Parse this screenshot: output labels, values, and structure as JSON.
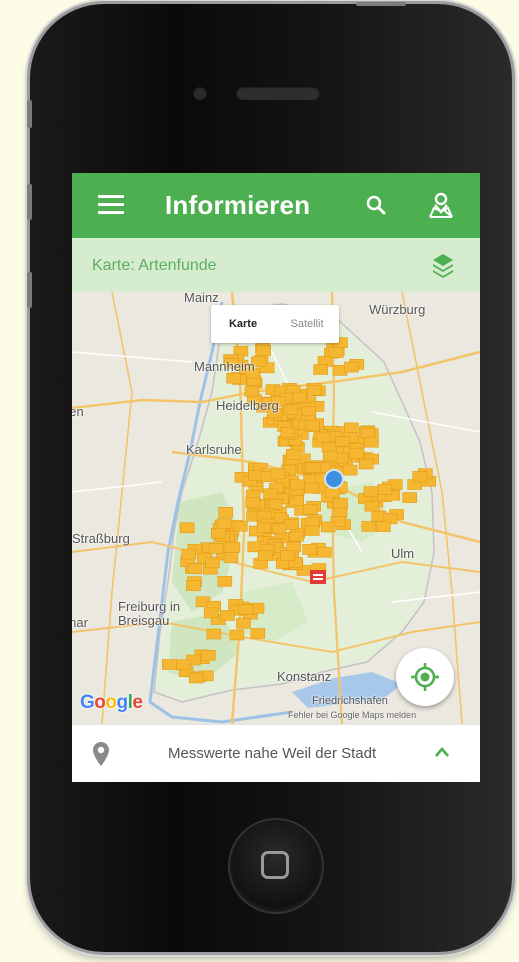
{
  "app": {
    "title": "Informieren",
    "accent_color": "#4caf50",
    "subbar_color": "#d6eccf"
  },
  "appbar": {
    "menu_icon": "menu-icon",
    "search_icon": "search-icon",
    "account_icon": "account-map-icon"
  },
  "subbar": {
    "label": "Karte: Artenfunde",
    "layers_icon": "layers-icon"
  },
  "map": {
    "map_type": {
      "karte": "Karte",
      "satellit": "Satellit",
      "selected": "Karte"
    },
    "cities": {
      "mainz": "Mainz",
      "wuerzburg": "Würzburg",
      "mannheim": "Mannheim",
      "heidelberg": "Heidelberg",
      "karlsruhe": "Karlsruhe",
      "strasbourg": "Straßburg",
      "ulm": "Ulm",
      "freiburg": "Freiburg in Breisgau",
      "konstanz": "Konstanz",
      "friedrichshafen": "Friedrichshafen",
      "saarbruecken": "Saarbrücken",
      "colmar": "Colmar"
    },
    "attribution": "Fehler bei Google Maps melden",
    "google_logo": "Google",
    "marker_color": "#f5b731",
    "selected_marker_color": "#e53935",
    "location_dot_color": "#3d8fe0"
  },
  "locate_button": {
    "icon": "my-location-icon"
  },
  "bottom_bar": {
    "label": "Messwerte nahe Weil der Stadt",
    "pin_icon": "map-pin-icon",
    "expand_icon": "chevron-up-icon"
  }
}
